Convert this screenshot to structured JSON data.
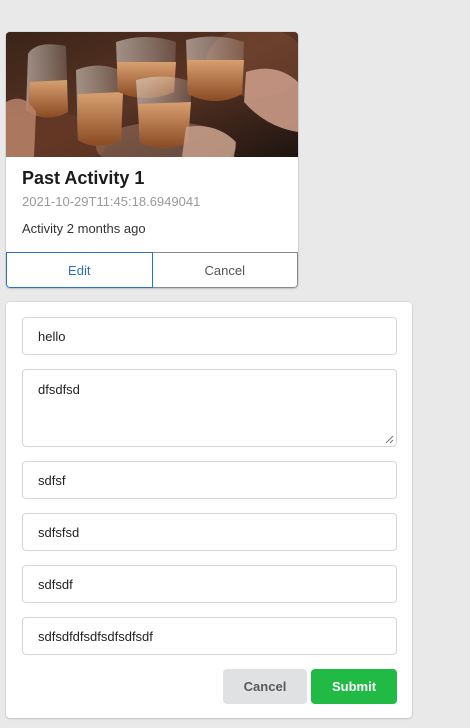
{
  "activity_card": {
    "image_alt": "beer-toast-photo",
    "title": "Past Activity 1",
    "date": "2021-10-29T11:45:18.6949041",
    "description": "Activity 2 months ago",
    "edit_label": "Edit",
    "cancel_label": "Cancel"
  },
  "form": {
    "title_value": "hello",
    "description_value": "dfsdfsd",
    "category_value": "sdfsf",
    "date_value": "sdfsfsd",
    "city_value": "sdfsdf",
    "venue_value": "sdfsdfdfsdfsdfsdfsdf",
    "cancel_label": "Cancel",
    "submit_label": "Submit"
  },
  "colors": {
    "background": "#e9e9e9",
    "edit_blue": "#2b73c9",
    "submit_green": "#21ba45",
    "cancel_grey": "#e0e1e2"
  }
}
